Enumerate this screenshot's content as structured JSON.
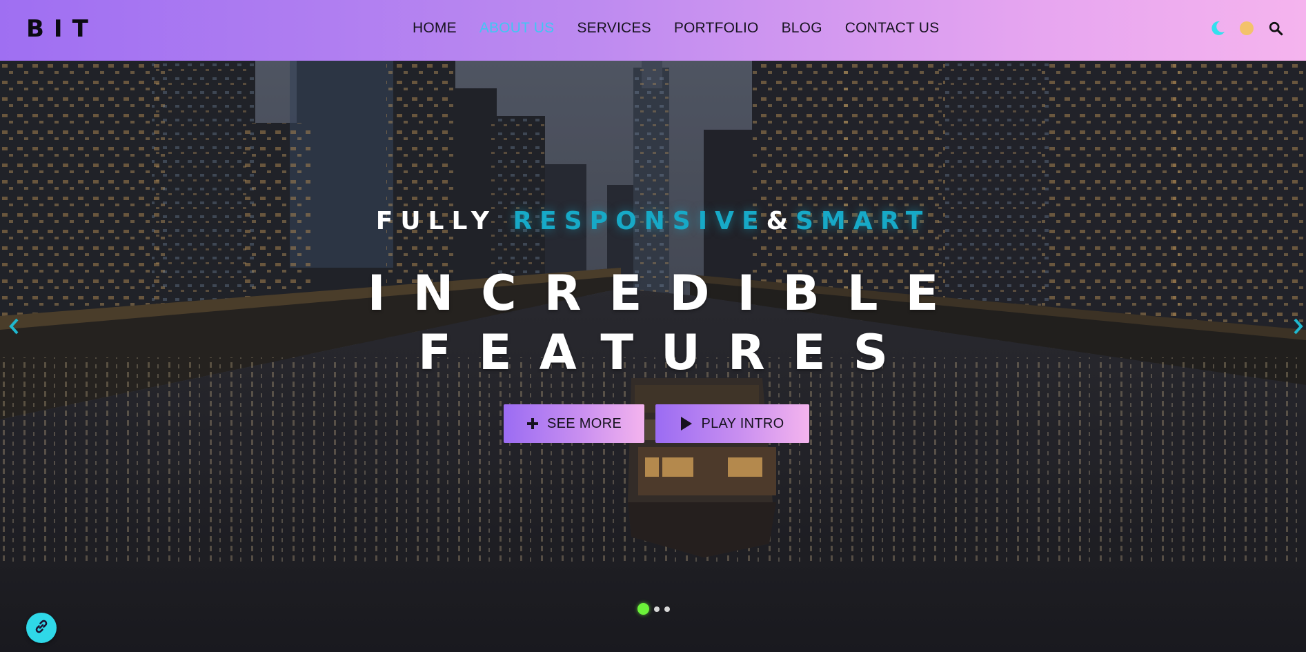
{
  "brand": {
    "logo": "BIT"
  },
  "nav": {
    "items": [
      {
        "label": "HOME",
        "active": false
      },
      {
        "label": "ABOUT US",
        "active": true
      },
      {
        "label": "SERVICES",
        "active": false
      },
      {
        "label": "PORTFOLIO",
        "active": false
      },
      {
        "label": "BLOG",
        "active": false
      },
      {
        "label": "CONTACT US",
        "active": false
      }
    ],
    "active_color": "#41c6f2"
  },
  "header_icons": [
    "moon-icon",
    "sun-icon",
    "search-icon"
  ],
  "hero": {
    "subtitle": {
      "part1": "FULLY ",
      "highlight1": "RESPONSIVE",
      "amp": "&",
      "highlight2": "SMART"
    },
    "headline_line1": "INCREDIBLE",
    "headline_line2": "FEATURES",
    "buttons": {
      "see_more": "SEE MORE",
      "play_intro": "PLAY INTRO"
    },
    "slide_count": 3,
    "active_slide": 1
  },
  "colors": {
    "header_gradient_start": "#9f6ff2",
    "header_gradient_end": "#f5b4ee",
    "accent_cyan": "#17a9c7",
    "active_dot": "#6cf23a",
    "fab": "#2fd8e8"
  },
  "fab_icon": "link-icon"
}
